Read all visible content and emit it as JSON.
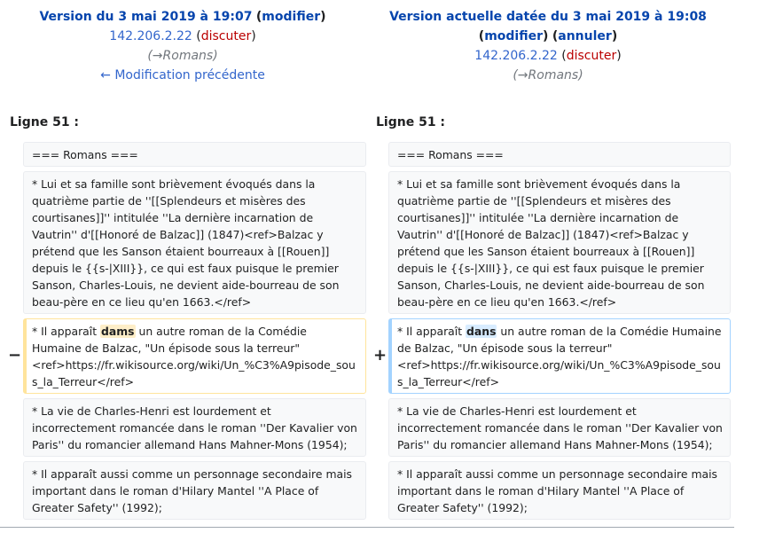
{
  "old": {
    "title": "Version du 3 mai 2019 à 19:07",
    "edit_link": "modifier",
    "ip": "142.206.2.22",
    "talk": "discuter",
    "summary": "(→Romans)",
    "prev_link": "← Modification précédente"
  },
  "new": {
    "title": "Version actuelle datée du 3 mai 2019 à 19:08",
    "edit_link": "modifier",
    "undo_link": "annuler",
    "ip": "142.206.2.22",
    "talk": "discuter",
    "summary": "(→Romans)"
  },
  "line_label": "Ligne 51 :",
  "markers": {
    "minus": "−",
    "plus": "+"
  },
  "rows": {
    "r1": "=== Romans ===",
    "r2": "* Lui et sa famille sont brièvement évoqués dans la quatrième partie de ''[[Splendeurs et misères des courtisanes]]'' intitulée ''La dernière incarnation de Vautrin'' d'[[Honoré de Balzac]] (1847)<ref>Balzac y prétend que les Sanson étaient bourreaux à [[Rouen]] depuis le {{s-|XIII}}, ce qui est faux puisque le premier Sanson, Charles-Louis, ne devient aide-bourreau de son beau-père en ce lieu qu'en 1663.</ref>",
    "changed_prefix": "* Il apparaît ",
    "old_word": "dams",
    "new_word": "dans",
    "changed_suffix": " un autre roman de la Comédie Humaine de Balzac, \"Un épisode sous la terreur\" <ref>https://fr.wikisource.org/wiki/Un_%C3%A9pisode_sous_la_Terreur</ref>",
    "r4": "* La vie de Charles-Henri est lourdement et incorrectement romancée dans le roman ''Der Kavalier von Paris'' du romancier allemand Hans Mahner-Mons (1954);",
    "r5": "* Il apparaît aussi comme un personnage secondaire mais important dans le roman d'Hilary Mantel ''A Place of Greater Safety'' (1992);"
  },
  "colors": {
    "deleted_border": "#ffe49c",
    "added_border": "#a3d3ff",
    "link": "#0645ad",
    "redlink": "#ba0000"
  }
}
